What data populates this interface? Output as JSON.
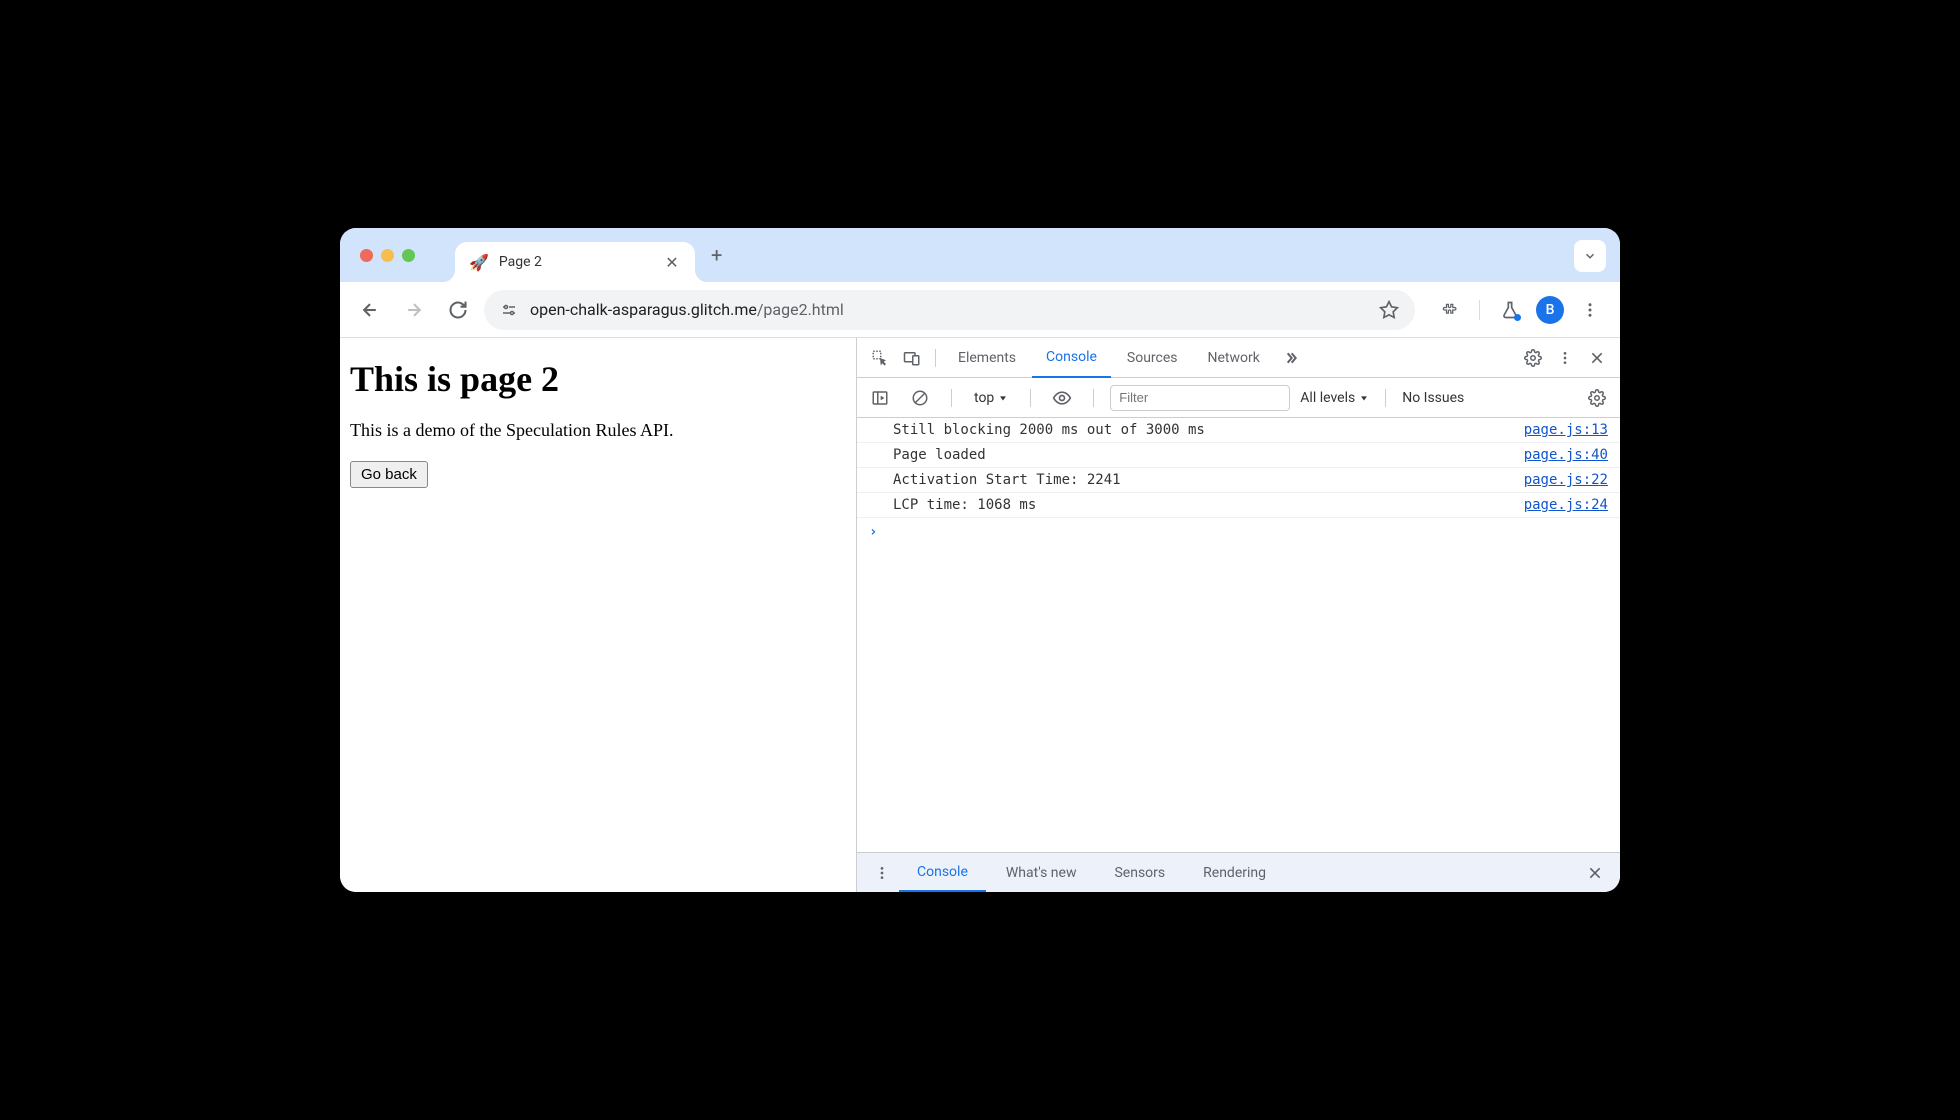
{
  "browser": {
    "tab_title": "Page 2",
    "url_host": "open-chalk-asparagus.glitch.me",
    "url_path": "/page2.html",
    "avatar_letter": "B"
  },
  "page": {
    "heading": "This is page 2",
    "paragraph": "This is a demo of the Speculation Rules API.",
    "back_button": "Go back"
  },
  "devtools": {
    "tabs": [
      "Elements",
      "Console",
      "Sources",
      "Network"
    ],
    "active_tab": "Console",
    "context": "top",
    "filter_placeholder": "Filter",
    "levels_label": "All levels",
    "issues_label": "No Issues",
    "console_rows": [
      {
        "msg": "Still blocking 2000 ms out of 3000 ms",
        "src": "page.js:13"
      },
      {
        "msg": "Page loaded",
        "src": "page.js:40"
      },
      {
        "msg": "Activation Start Time: 2241",
        "src": "page.js:22"
      },
      {
        "msg": "LCP time: 1068 ms",
        "src": "page.js:24"
      }
    ],
    "drawer_tabs": [
      "Console",
      "What's new",
      "Sensors",
      "Rendering"
    ],
    "drawer_active": "Console"
  }
}
